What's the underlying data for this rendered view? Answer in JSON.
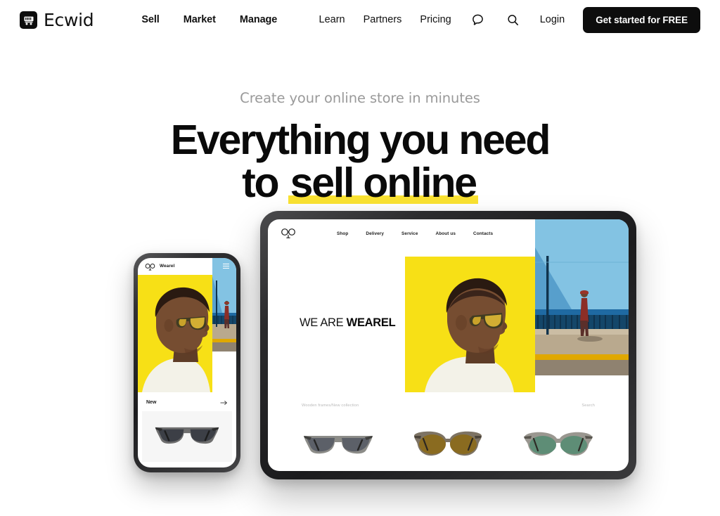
{
  "header": {
    "brand_name": "Ecwid",
    "brand_icon": "shopping-cart-icon",
    "nav_primary": [
      {
        "label": "Sell"
      },
      {
        "label": "Market"
      },
      {
        "label": "Manage"
      }
    ],
    "nav_secondary": [
      {
        "label": "Learn"
      },
      {
        "label": "Partners"
      },
      {
        "label": "Pricing"
      }
    ],
    "chat_icon": "speech-bubble-icon",
    "search_icon": "search-icon",
    "login_label": "Login",
    "cta_label": "Get started for FREE"
  },
  "hero": {
    "eyebrow": "Create your online store in minutes",
    "headline_line1": "Everything you need",
    "headline_line2_prefix": "to ",
    "headline_line2_highlight": "sell online",
    "highlight_color": "#fae232"
  },
  "tablet_mockup": {
    "logo_icon": "glasses-logo-icon",
    "nav": [
      {
        "label": "Shop"
      },
      {
        "label": "Delivery"
      },
      {
        "label": "Service"
      },
      {
        "label": "About us"
      },
      {
        "label": "Contacts"
      }
    ],
    "claim_light": "WE ARE ",
    "claim_bold": "WEAREL",
    "breadcrumb": "Wooden frames/New collection",
    "search_label": "Search",
    "panel_yellow_color": "#f7e016",
    "products": [
      {
        "name": "square-sunglasses",
        "lens_color": "#5c6068",
        "frame_color": "#8a8a86"
      },
      {
        "name": "round-amber-sunglasses",
        "lens_color": "#8a6b20",
        "frame_color": "#7d7364"
      },
      {
        "name": "round-green-sunglasses",
        "lens_color": "#5e8d76",
        "frame_color": "#9a9790"
      }
    ]
  },
  "phone_mockup": {
    "logo_icon": "glasses-logo-icon",
    "brand_name": "Wearel",
    "menu_icon": "hamburger-menu-icon",
    "section_label": "New",
    "arrow_icon": "arrow-right-icon",
    "panel_yellow_color": "#f7e016",
    "product": {
      "name": "square-sunglasses",
      "lens_color": "#3c3f46",
      "frame_color": "#6e6e6e"
    }
  }
}
